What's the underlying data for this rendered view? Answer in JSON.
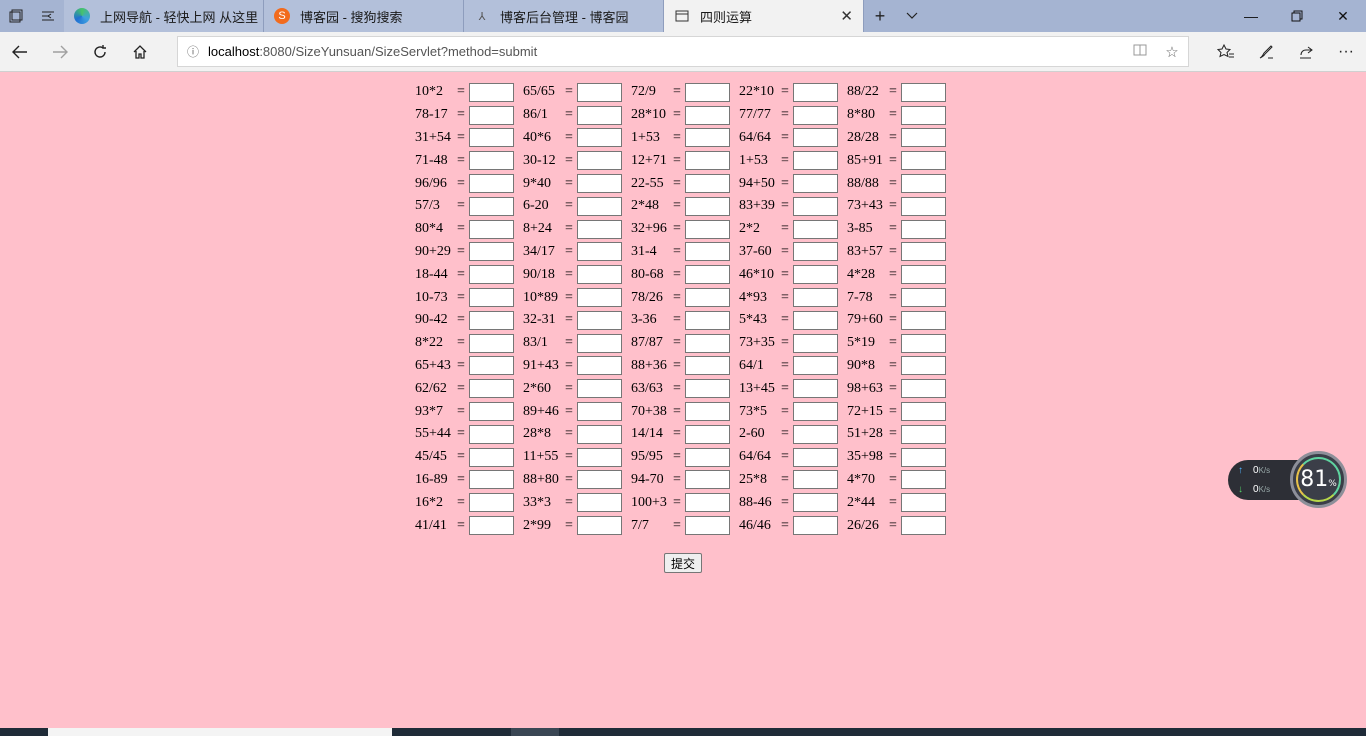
{
  "browser": {
    "tabs": [
      {
        "title": "上网导航 - 轻快上网 从这里",
        "icon": "edge-icon",
        "icon_color": "#3fa0e0"
      },
      {
        "title": "博客园 - 搜狗搜索",
        "icon": "sogou-icon",
        "icon_color": "#f26b1d"
      },
      {
        "title": "博客后台管理 - 博客园",
        "icon": "cnblogs-icon",
        "icon_color": "#555555"
      },
      {
        "title": "四则运算",
        "icon": "page-icon",
        "icon_color": "#333333",
        "active": true
      }
    ],
    "url_host": "localhost",
    "url_path": ":8080/SizeYunsuan/SizeServlet?method=submit"
  },
  "quiz": {
    "rows": [
      [
        "10*2",
        "65/65",
        "72/9",
        "22*10",
        "88/22"
      ],
      [
        "78-17",
        "86/1",
        "28*10",
        "77/77",
        "8*80"
      ],
      [
        "31+54",
        "40*6",
        "1+53",
        "64/64",
        "28/28"
      ],
      [
        "71-48",
        "30-12",
        "12+71",
        "1+53",
        "85+91"
      ],
      [
        "96/96",
        "9*40",
        "22-55",
        "94+50",
        "88/88"
      ],
      [
        "57/3",
        "6-20",
        "2*48",
        "83+39",
        "73+43"
      ],
      [
        "80*4",
        "8+24",
        "32+96",
        "2*2",
        "3-85"
      ],
      [
        "90+29",
        "34/17",
        "31-4",
        "37-60",
        "83+57"
      ],
      [
        "18-44",
        "90/18",
        "80-68",
        "46*10",
        "4*28"
      ],
      [
        "10-73",
        "10*89",
        "78/26",
        "4*93",
        "7-78"
      ],
      [
        "90-42",
        "32-31",
        "3-36",
        "5*43",
        "79+60"
      ],
      [
        "8*22",
        "83/1",
        "87/87",
        "73+35",
        "5*19"
      ],
      [
        "65+43",
        "91+43",
        "88+36",
        "64/1",
        "90*8"
      ],
      [
        "62/62",
        "2*60",
        "63/63",
        "13+45",
        "98+63"
      ],
      [
        "93*7",
        "89+46",
        "70+38",
        "73*5",
        "72+15"
      ],
      [
        "55+44",
        "28*8",
        "14/14",
        "2-60",
        "51+28"
      ],
      [
        "45/45",
        "11+55",
        "95/95",
        "64/64",
        "35+98"
      ],
      [
        "16-89",
        "88+80",
        "94-70",
        "25*8",
        "4*70"
      ],
      [
        "16*2",
        "33*3",
        "100+3",
        "88-46",
        "2*44"
      ],
      [
        "41/41",
        "2*99",
        "7/7",
        "46/46",
        "26/26"
      ]
    ],
    "equals": "=",
    "submit_label": "提交"
  },
  "net_widget": {
    "up_value": "0",
    "down_value": "0",
    "unit": "K/s",
    "gauge_value": "81",
    "gauge_unit": "%"
  }
}
